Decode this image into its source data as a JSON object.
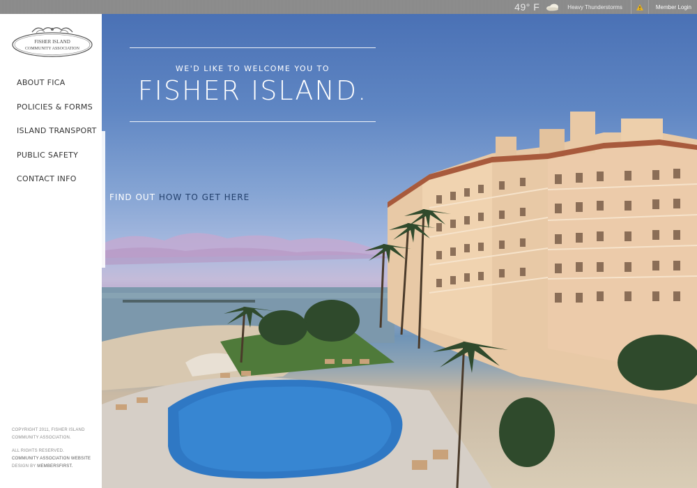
{
  "weather": {
    "temperature": "49° F",
    "icon": "cloud-icon",
    "condition": "Heavy Thunderstorms",
    "alert_icon": "warning-icon"
  },
  "header": {
    "login_label": "Member Login"
  },
  "logo": {
    "line1": "FISHER ISLAND",
    "line2": "COMMUNITY ASSOCIATION"
  },
  "nav": {
    "items": [
      {
        "label": "ABOUT FICA"
      },
      {
        "label": "POLICIES & FORMS"
      },
      {
        "label": "ISLAND TRANSPORT"
      },
      {
        "label": "PUBLIC SAFETY"
      },
      {
        "label": "CONTACT INFO"
      }
    ]
  },
  "hero": {
    "welcome": "WE'D LIKE TO WELCOME YOU TO",
    "headline": "FISHER ISLAND.",
    "findout_prefix": "FIND OUT",
    "findout_link": "HOW TO GET HERE"
  },
  "footer": {
    "copyright": "COPYRIGHT 2011, FISHER ISLAND COMMUNITY ASSOCIATION.",
    "rights": "ALL RIGHTS RESERVED.",
    "credit_link": "COMMUNITY ASSOCIATION WEBSITE",
    "credit_by": "DESIGN BY",
    "credit_company": "MEMBERSFIRST."
  },
  "colors": {
    "sky": "#5f86c3",
    "link": "#23406d",
    "topbar": "#8b8b8b"
  }
}
